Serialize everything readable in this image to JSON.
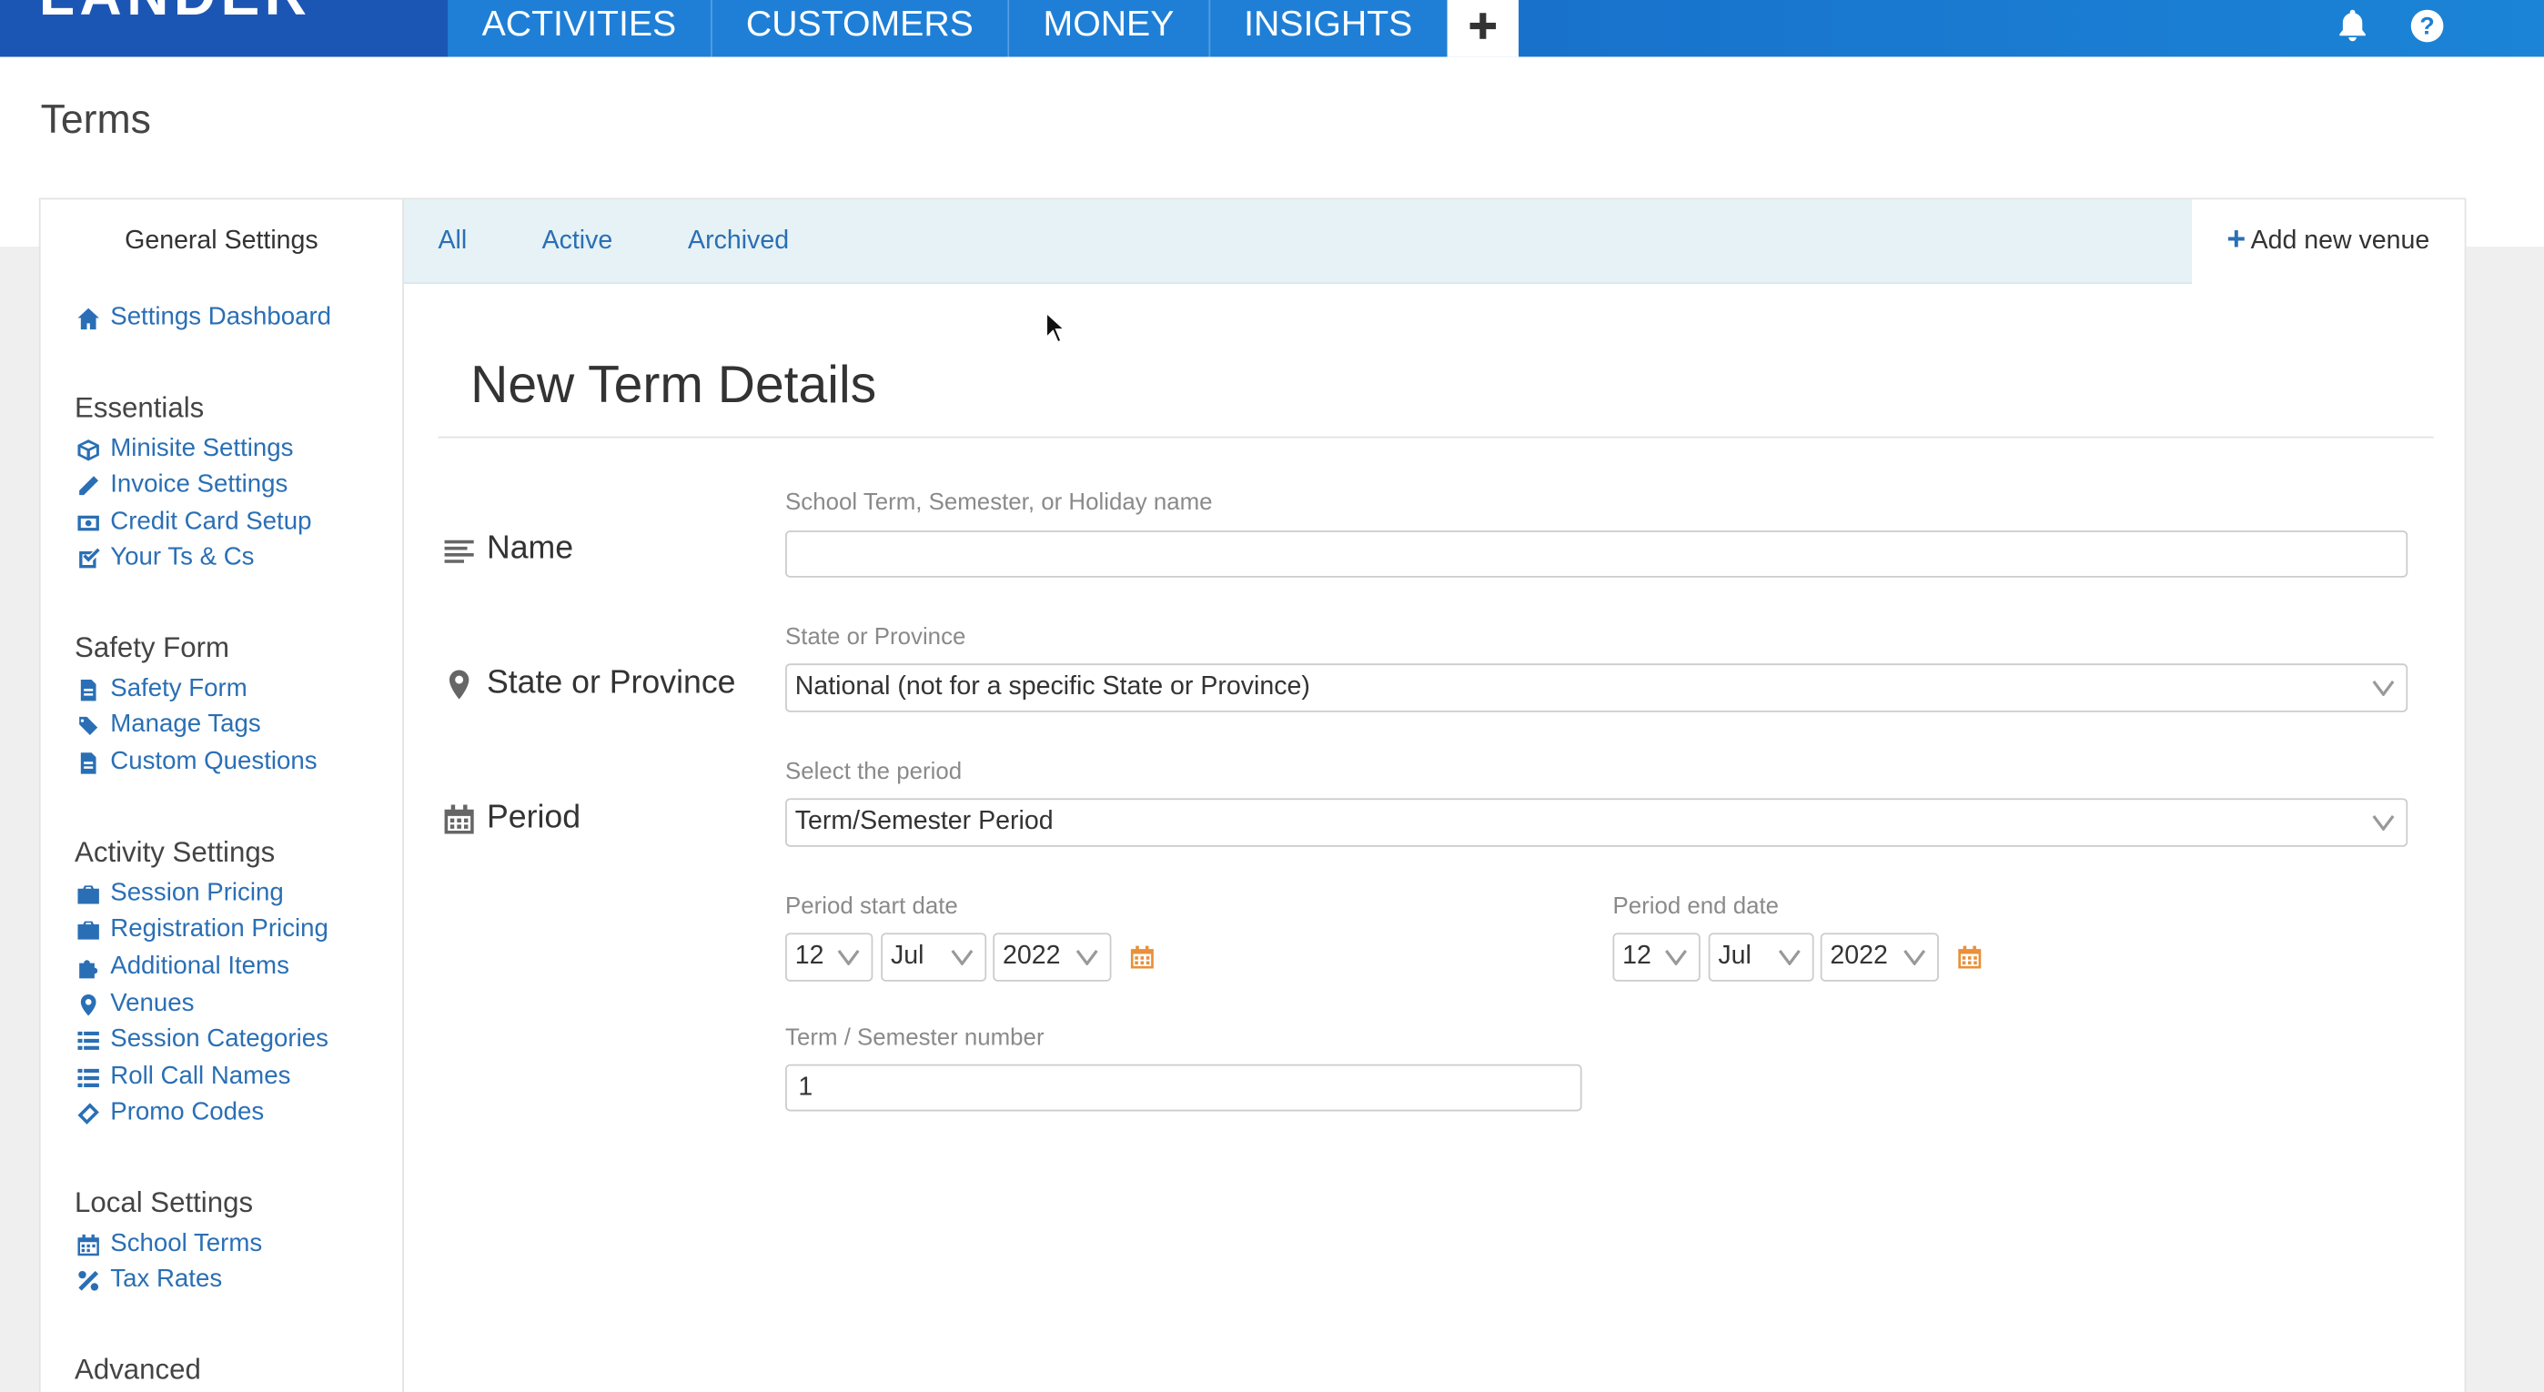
{
  "topbar": {
    "logo": "LANDER",
    "nav": [
      "ACTIVITIES",
      "CUSTOMERS",
      "MONEY",
      "INSIGHTS"
    ],
    "plus": "+",
    "icons": [
      "bell-icon",
      "help-icon"
    ]
  },
  "page": {
    "title": "Terms"
  },
  "sidebar": {
    "heading": "General Settings",
    "dashboard": "Settings Dashboard",
    "sections": [
      {
        "title": "Essentials",
        "items": [
          "Minisite Settings",
          "Invoice Settings",
          "Credit Card Setup",
          "Your Ts & Cs"
        ]
      },
      {
        "title": "Safety Form",
        "items": [
          "Safety Form",
          "Manage Tags",
          "Custom Questions"
        ]
      },
      {
        "title": "Activity Settings",
        "items": [
          "Session Pricing",
          "Registration Pricing",
          "Additional Items",
          "Venues",
          "Session Categories",
          "Roll Call Names",
          "Promo Codes"
        ]
      },
      {
        "title": "Local Settings",
        "items": [
          "School Terms",
          "Tax Rates"
        ]
      },
      {
        "title": "Advanced",
        "items": []
      }
    ]
  },
  "tabs": {
    "all": "All",
    "active": "Active",
    "archived": "Archived",
    "add_venue": "Add new venue"
  },
  "form": {
    "title": "New Term Details",
    "name": {
      "label": "Name",
      "help": "School Term, Semester, or Holiday name",
      "value": ""
    },
    "state": {
      "label": "State or Province",
      "help": "State or Province",
      "value": "National (not for a specific State or Province)"
    },
    "period": {
      "label": "Period",
      "help": "Select the period",
      "value": "Term/Semester Period",
      "start": {
        "help": "Period start date",
        "day": "12",
        "month": "Jul",
        "year": "2022"
      },
      "end": {
        "help": "Period end date",
        "day": "12",
        "month": "Jul",
        "year": "2022"
      }
    },
    "term_number": {
      "help": "Term / Semester number",
      "value": "1"
    }
  },
  "colors": {
    "nav_blue": "#1b57b9",
    "link_blue": "#2a6fb5",
    "tab_bg": "#e6f2f5",
    "calendar_orange": "#e8903a"
  }
}
